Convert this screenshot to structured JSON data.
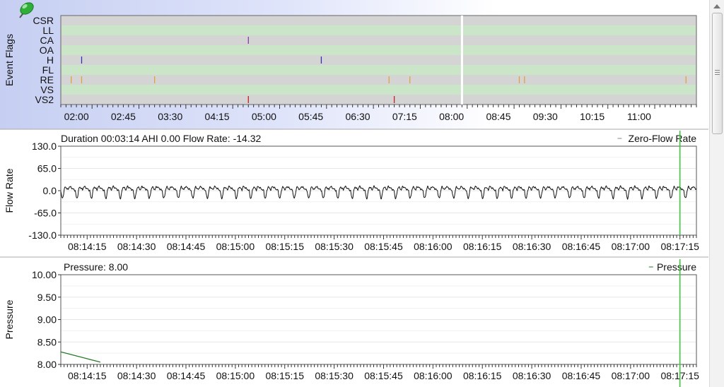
{
  "colors": {
    "event_panel_bg": "#ccd4f4",
    "lane_green": "#cbe5c9",
    "lane_grey": "#d4d4d4",
    "flow_line": "#111111",
    "pressure_line": "#2a7a2a",
    "cursor_green": "#33cc33",
    "flag_CA": "#8040a0",
    "flag_H": "#3030b0",
    "flag_RE": "#e0a040",
    "flag_VS2": "#c02020"
  },
  "icons": {
    "pin": "pushpin-icon"
  },
  "event_panel": {
    "ylabel": "Event Flags",
    "rows": [
      "CSR",
      "LL",
      "CA",
      "OA",
      "H",
      "FL",
      "RE",
      "VS",
      "VS2"
    ],
    "ticks": [
      "02:00",
      "02:45",
      "03:30",
      "04:15",
      "05:00",
      "05:45",
      "06:30",
      "07:15",
      "08:00",
      "08:45",
      "09:30",
      "10:15",
      "11:00"
    ]
  },
  "flow_panel": {
    "header": "Duration 00:03:14 AHI 0.00 Flow Rate: -14.32",
    "legend": "Zero-Flow Rate",
    "ylabel": "Flow Rate",
    "yticks": [
      "130.0",
      "65.0",
      "0.0",
      "-65.0",
      "-130.0"
    ],
    "xticks": [
      "08:14:15",
      "08:14:30",
      "08:14:45",
      "08:15:00",
      "08:15:15",
      "08:15:30",
      "08:15:45",
      "08:16:00",
      "08:16:15",
      "08:16:30",
      "08:16:45",
      "08:17:00",
      "08:17:15"
    ]
  },
  "pressure_panel": {
    "header": "Pressure: 8.00",
    "legend": "Pressure",
    "ylabel": "Pressure",
    "yticks": [
      "10.00",
      "9.50",
      "9.00",
      "8.50",
      "8.00"
    ],
    "xticks": [
      "08:14:15",
      "08:14:30",
      "08:14:45",
      "08:15:00",
      "08:15:15",
      "08:15:30",
      "08:15:45",
      "08:16:00",
      "08:16:15",
      "08:16:30",
      "08:16:45",
      "08:17:00",
      "08:17:15"
    ]
  },
  "chart_data": [
    {
      "type": "scatter",
      "ylabel": "Event Flags",
      "x_range": [
        "01:45",
        "11:55"
      ],
      "cursor_time": "08:10",
      "events": [
        {
          "flag": "CA",
          "times": [
            "04:45"
          ]
        },
        {
          "flag": "H",
          "times": [
            "02:05",
            "05:55"
          ]
        },
        {
          "flag": "RE",
          "times": [
            "01:55",
            "02:05",
            "03:15",
            "07:00",
            "07:20",
            "09:05",
            "09:10",
            "11:45"
          ]
        },
        {
          "flag": "VS2",
          "times": [
            "04:45",
            "07:05"
          ]
        }
      ]
    },
    {
      "type": "line",
      "ylabel": "Flow Rate",
      "x_range": [
        "08:14:07",
        "08:17:20"
      ],
      "ylim": [
        -130,
        130
      ],
      "breath_period_s": 4.4,
      "breath_peak": 12,
      "breath_trough": -22,
      "cursor_time": "08:17:15",
      "series": [
        {
          "name": "Zero-Flow Rate",
          "values": []
        }
      ]
    },
    {
      "type": "line",
      "ylabel": "Pressure",
      "x_range": [
        "08:14:07",
        "08:17:20"
      ],
      "ylim": [
        8.0,
        10.0
      ],
      "cursor_time": "08:17:15",
      "series": [
        {
          "name": "Pressure",
          "x": [
            "08:14:07",
            "08:14:19"
          ],
          "values": [
            8.28,
            8.05
          ]
        }
      ]
    }
  ]
}
